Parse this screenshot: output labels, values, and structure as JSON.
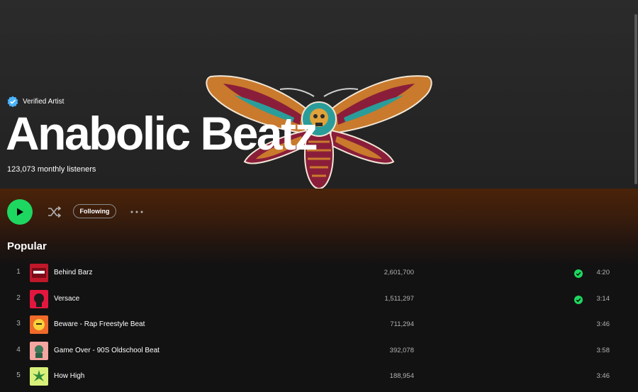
{
  "artist": {
    "verified_label": "Verified Artist",
    "name": "Anabolic Beatz",
    "monthly_listeners": "123,073 monthly listeners"
  },
  "actions": {
    "play_icon": "play-icon",
    "shuffle_icon": "shuffle-icon",
    "following_label": "Following",
    "more_icon": "more-options-icon"
  },
  "popular": {
    "title": "Popular",
    "tracks": [
      {
        "number": "1",
        "title": "Behind Barz",
        "plays": "2,601,700",
        "saved": true,
        "duration": "4:20"
      },
      {
        "number": "2",
        "title": "Versace",
        "plays": "1,511,297",
        "saved": true,
        "duration": "3:14"
      },
      {
        "number": "3",
        "title": "Beware - Rap Freestyle Beat",
        "plays": "711,294",
        "saved": false,
        "duration": "3:46"
      },
      {
        "number": "4",
        "title": "Game Over - 90S Oldschool Beat",
        "plays": "392,078",
        "saved": false,
        "duration": "3:58"
      },
      {
        "number": "5",
        "title": "How High",
        "plays": "188,954",
        "saved": false,
        "duration": "3:46"
      }
    ]
  },
  "colors": {
    "accent_green": "#1ed760",
    "background": "#121212",
    "band_brown": "#4a2309"
  }
}
